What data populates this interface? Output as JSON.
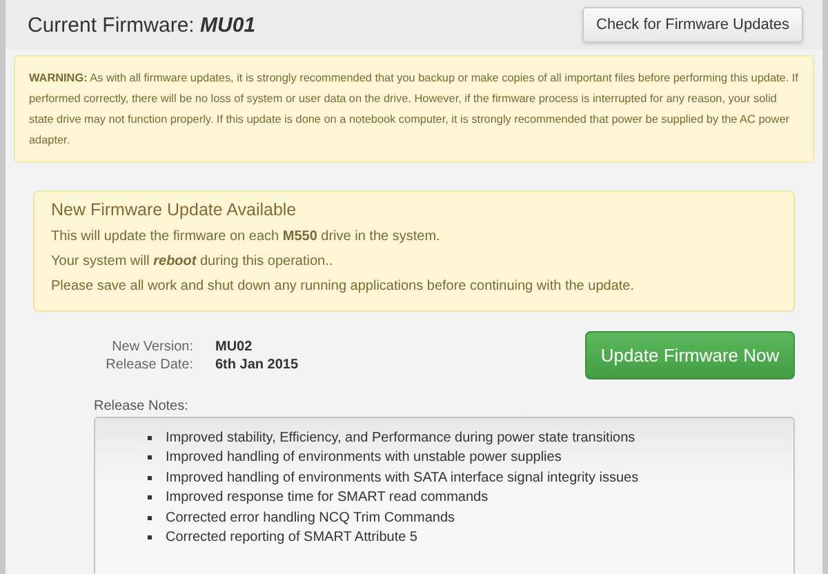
{
  "header": {
    "title": "Current Firmware:",
    "version": "MU01",
    "check_button": "Check for Firmware Updates"
  },
  "warning": "**WARNING:** As with all firmware updates, it is strongly recommended that you backup or make copies of all important files before performing this update. If performed correctly, there will be no loss of system or user data on the drive. However, if the firmware process is interrupted for any reason, your solid state drive may not function properly. If this update is done on a notebook computer, it is strongly recommended that power be supplied by the AC power adapter.",
  "update_notice": {
    "title": "New Firmware Update Available",
    "lines": [
      "This will update the firmware on each **M550** drive in the system.",
      "Your system will *reboot* during this operation..",
      "Please save all work and shut down any running applications before continuing with the update."
    ]
  },
  "details": [
    {
      "label": "New Version:",
      "value": "MU02"
    },
    {
      "label": "Release Date:",
      "value": "6th Jan 2015"
    }
  ],
  "update_button": "Update Firmware Now",
  "release_notes": {
    "label": "Release Notes:",
    "items": [
      "Improved stability, Efficiency, and Performance during power state transitions",
      "Improved handling of environments with unstable power supplies",
      "Improved handling of environments with SATA interface signal integrity issues",
      "Improved response time for SMART read commands",
      "Corrected error handling NCQ Trim Commands",
      "Corrected reporting of SMART Attribute 5"
    ]
  }
}
